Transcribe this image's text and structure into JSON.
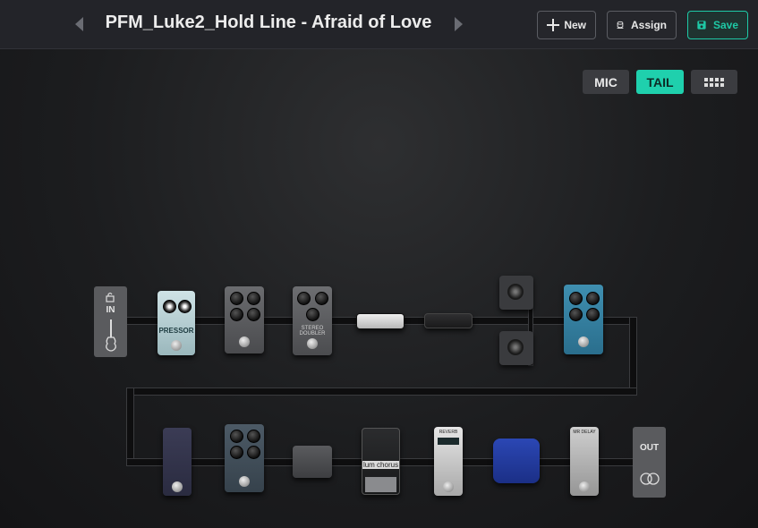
{
  "header": {
    "preset_name": "PFM_Luke2_Hold Line - Afraid of Love",
    "new_label": "New",
    "assign_label": "Assign",
    "save_label": "Save"
  },
  "view_toggle": {
    "mic_label": "MIC",
    "tail_label": "TAIL",
    "active": "TAIL"
  },
  "chain": {
    "input_label": "IN",
    "output_label": "OUT",
    "row1": [
      "compressor",
      "overdrive",
      "stereo-doubler",
      "amp-head",
      "amp-head-2",
      "cabinet",
      "air-reverb"
    ],
    "row2": [
      "phaser",
      "overdrive-2",
      "graphic-eq",
      "chorus",
      "reverb",
      "pitch-delay",
      "delay"
    ],
    "pedal_labels": {
      "pressor": "PRESSOR",
      "stereo_doubler": "STEREO DOUBLER",
      "chorus": "lum chorus",
      "reverb": "REVERB",
      "delay": "MR DELAY"
    }
  },
  "colors": {
    "accent": "#1fd0ad",
    "topbar": "#232429",
    "background": "#1b1c1f"
  }
}
